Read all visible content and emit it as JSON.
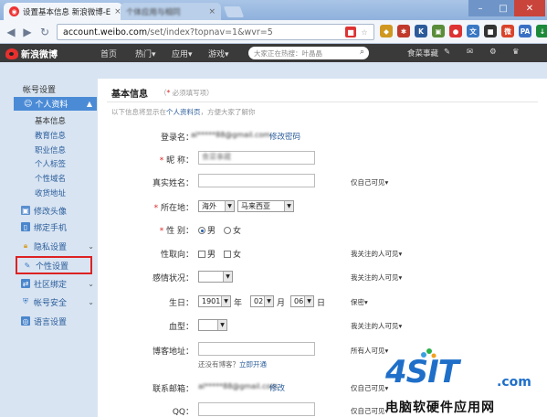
{
  "browser": {
    "active_tab_title": "设置基本信息 新浪微博-E",
    "inactive_tab_title": "个体应用与相同",
    "url_domain": "account.weibo.com",
    "url_path": "/set/index?topnav=1&wvr=5",
    "omni_icons": [
      "bookmark-icon",
      "star-icon"
    ],
    "extensions": [
      {
        "name": "ext-bird-icon",
        "label": "◆",
        "color": "#d09820"
      },
      {
        "name": "ext-gear-icon",
        "label": "✱",
        "color": "#c0392b"
      },
      {
        "name": "ext-k-icon",
        "label": "K",
        "color": "#2d5b9a"
      },
      {
        "name": "ext-image-icon",
        "label": "▣",
        "color": "#5b8c3a"
      },
      {
        "name": "ext-circle-icon",
        "label": "●",
        "color": "#d33"
      },
      {
        "name": "ext-translate-icon",
        "label": "文",
        "color": "#3a78c4"
      },
      {
        "name": "ext-dot-icon",
        "label": "■",
        "color": "#333"
      },
      {
        "name": "ext-weibo-icon",
        "label": "微",
        "color": "#d9442b"
      },
      {
        "name": "ext-ppa-icon",
        "label": "PA",
        "color": "#3a6fc4"
      },
      {
        "name": "ext-download-icon",
        "label": "↓",
        "color": "#1d8a3a"
      },
      {
        "name": "ext-menu-icon",
        "label": "≡",
        "color": "#777"
      }
    ]
  },
  "topnav": {
    "logo_text": "新浪微博",
    "items": [
      "首页",
      "热门▾",
      "应用▾",
      "游戏▾"
    ],
    "search_placeholder": "大家正在热搜：叶晶晶",
    "user": "食菜事藏",
    "icons": [
      "edit-icon",
      "mail-icon",
      "settings-icon",
      "crown-icon"
    ]
  },
  "sidebar": {
    "heading": "帐号设置",
    "active_section": "个人资料",
    "sub_items": [
      "基本信息",
      "教育信息",
      "职业信息",
      "个人标签",
      "个性域名",
      "收货地址"
    ],
    "items": [
      {
        "label": "修改头像",
        "icon": "avatar-icon",
        "has_arrow": false
      },
      {
        "label": "绑定手机",
        "icon": "phone-icon",
        "has_arrow": false
      },
      {
        "label": "隐私设置",
        "icon": "lock-icon",
        "has_arrow": true
      },
      {
        "label": "个性设置",
        "icon": "wrench-icon",
        "has_arrow": false
      },
      {
        "label": "社区绑定",
        "icon": "community-icon",
        "has_arrow": true
      },
      {
        "label": "帐号安全",
        "icon": "shield-icon",
        "has_arrow": true
      },
      {
        "label": "语言设置",
        "icon": "globe-icon",
        "has_arrow": false
      }
    ]
  },
  "main": {
    "title": "基本信息",
    "required_note": "（* 必须填写项）",
    "info_note_prefix": "以下信息将显示在",
    "info_note_link": "个人资料页",
    "info_note_suffix": "，方便大家了解你",
    "login_label": "登录名：",
    "login_value": "al*****88@gmail.com",
    "change_password": "修改密码",
    "nickname_label": "昵  称：",
    "nickname_value": "食菜事藏",
    "realname_label": "真实姓名：",
    "realname_privacy": "仅自己可见▾",
    "location_label": "所在地：",
    "location_country": "海外",
    "location_region": "马来西亚",
    "gender_label": "性  别：",
    "gender_male": "男",
    "gender_female": "女",
    "orientation_label": "性取向：",
    "orientation_male": "男",
    "orientation_female": "女",
    "orientation_privacy": "我关注的人可见▾",
    "relationship_label": "感情状况：",
    "relationship_privacy": "我关注的人可见▾",
    "birthday_label": "生日：",
    "birth_year": "1901",
    "birth_year_unit": "年",
    "birth_month": "02",
    "birth_month_unit": "月",
    "birth_day": "06",
    "birth_day_unit": "日",
    "birthday_privacy": "保密▾",
    "blood_label": "血型：",
    "blood_privacy": "我关注的人可见▾",
    "blog_label": "博客地址：",
    "blog_privacy": "所有人可见▾",
    "blog_hint": "还没有博客？",
    "blog_hint_link": "立即开通",
    "email_label": "联系邮箱：",
    "email_value": "al*****88@gmail.com",
    "email_change": "修改",
    "email_privacy": "仅自己可见▾",
    "qq_label": "QQ：",
    "qq_privacy": "仅自己可见▾"
  },
  "watermark": {
    "logo": "4SIT",
    "suffix": ".com",
    "tagline": "电脑软硬件应用网"
  }
}
